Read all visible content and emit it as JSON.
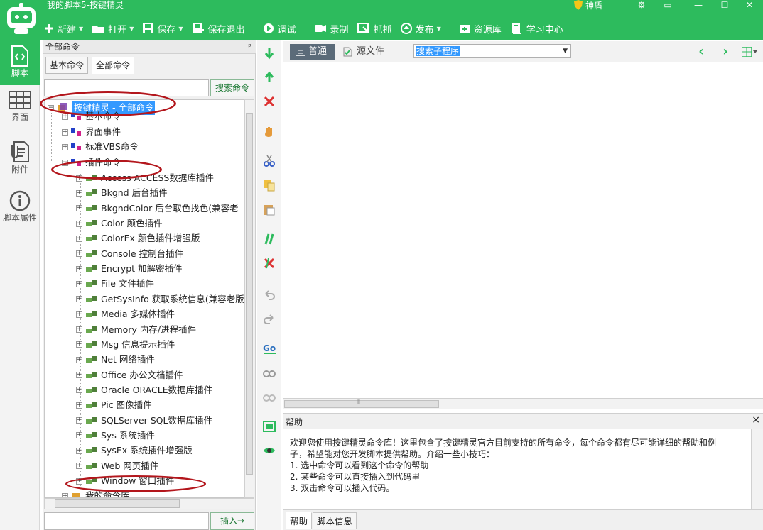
{
  "app": {
    "title": "我的脚本5-按键精灵",
    "shield_label": "神盾",
    "window_controls": [
      "gear-icon",
      "dropdown-box-icon",
      "minimize-icon",
      "close-icon"
    ]
  },
  "toolbar": {
    "items": [
      {
        "label": "新建",
        "icon": "plus-icon",
        "has_menu": true
      },
      {
        "label": "打开",
        "icon": "folder-icon",
        "has_menu": true
      },
      {
        "label": "保存",
        "icon": "save-icon",
        "has_menu": true
      },
      {
        "label": "保存退出",
        "icon": "save-exit-icon",
        "has_menu": false
      },
      {
        "label": "调试",
        "icon": "play-icon",
        "has_menu": false
      },
      {
        "label": "录制",
        "icon": "camera-icon",
        "has_menu": false
      },
      {
        "label": "抓抓",
        "icon": "capture-icon",
        "has_menu": false
      },
      {
        "label": "发布",
        "icon": "publish-icon",
        "has_menu": true
      },
      {
        "label": "资源库",
        "icon": "resource-icon",
        "has_menu": false
      },
      {
        "label": "学习中心",
        "icon": "learn-icon",
        "has_menu": false
      }
    ]
  },
  "sidebar": {
    "items": [
      {
        "label": "脚本",
        "icon": "script-icon",
        "active": true
      },
      {
        "label": "界面",
        "icon": "grid-icon",
        "active": false
      },
      {
        "label": "附件",
        "icon": "attachment-icon",
        "active": false
      },
      {
        "label": "脚本属性",
        "icon": "info-icon",
        "active": false
      }
    ]
  },
  "cmdpanel": {
    "header": "全部命令",
    "pin": "📌",
    "tabs": [
      "基本命令",
      "全部命令"
    ],
    "search_value": "",
    "search_button": "搜索命令",
    "insert_value": "",
    "insert_button": "插入→"
  },
  "tree": {
    "root": "按键精灵 - 全部命令",
    "groups": [
      "基本命令",
      "界面事件",
      "标准VBS命令",
      "插件命令"
    ],
    "plugins": [
      "Access ACCESS数据库插件",
      "Bkgnd 后台插件",
      "BkgndColor 后台取色找色(兼容老",
      "Color 颜色插件",
      "ColorEx 颜色插件增强版",
      "Console 控制台插件",
      "Encrypt 加解密插件",
      "File 文件插件",
      "GetSysInfo 获取系统信息(兼容老版",
      "Media 多媒体插件",
      "Memory 内存/进程插件",
      "Msg 信息提示插件",
      "Net 网络插件",
      "Office 办公文档插件",
      "Oracle ORACLE数据库插件",
      "Pic 图像插件",
      "SQLServer SQL数据库插件",
      "Sys 系统插件",
      "SysEx 系统插件增强版",
      "Web 网页插件",
      "Window 窗口插件"
    ],
    "tail": "我的命令库"
  },
  "editor": {
    "tab_normal": "普通",
    "tab_source": "源文件",
    "subprocedure_value": "搜索子程序",
    "nav_prev": "‹",
    "nav_next": "›",
    "hscroll_mark": "⦀"
  },
  "help": {
    "title": "帮助",
    "close": "×",
    "lines": [
      "欢迎您使用按键精灵命令库！这里包含了按键精灵官方目前支持的所有命令，每个命令都有尽可能详细的帮助和例",
      "子，希望能对您开发脚本提供帮助。介绍一些小技巧：",
      "1. 选中命令可以看到这个命令的帮助",
      "2. 某些命令可以直接插入到代码里",
      "3. 双击命令可以插入代码。"
    ],
    "tabs": [
      "帮助",
      "脚本信息"
    ]
  },
  "colors": {
    "brand_green": "#2dbb5d",
    "annotation_red": "#b3161c",
    "selection_blue": "#3399ff"
  }
}
